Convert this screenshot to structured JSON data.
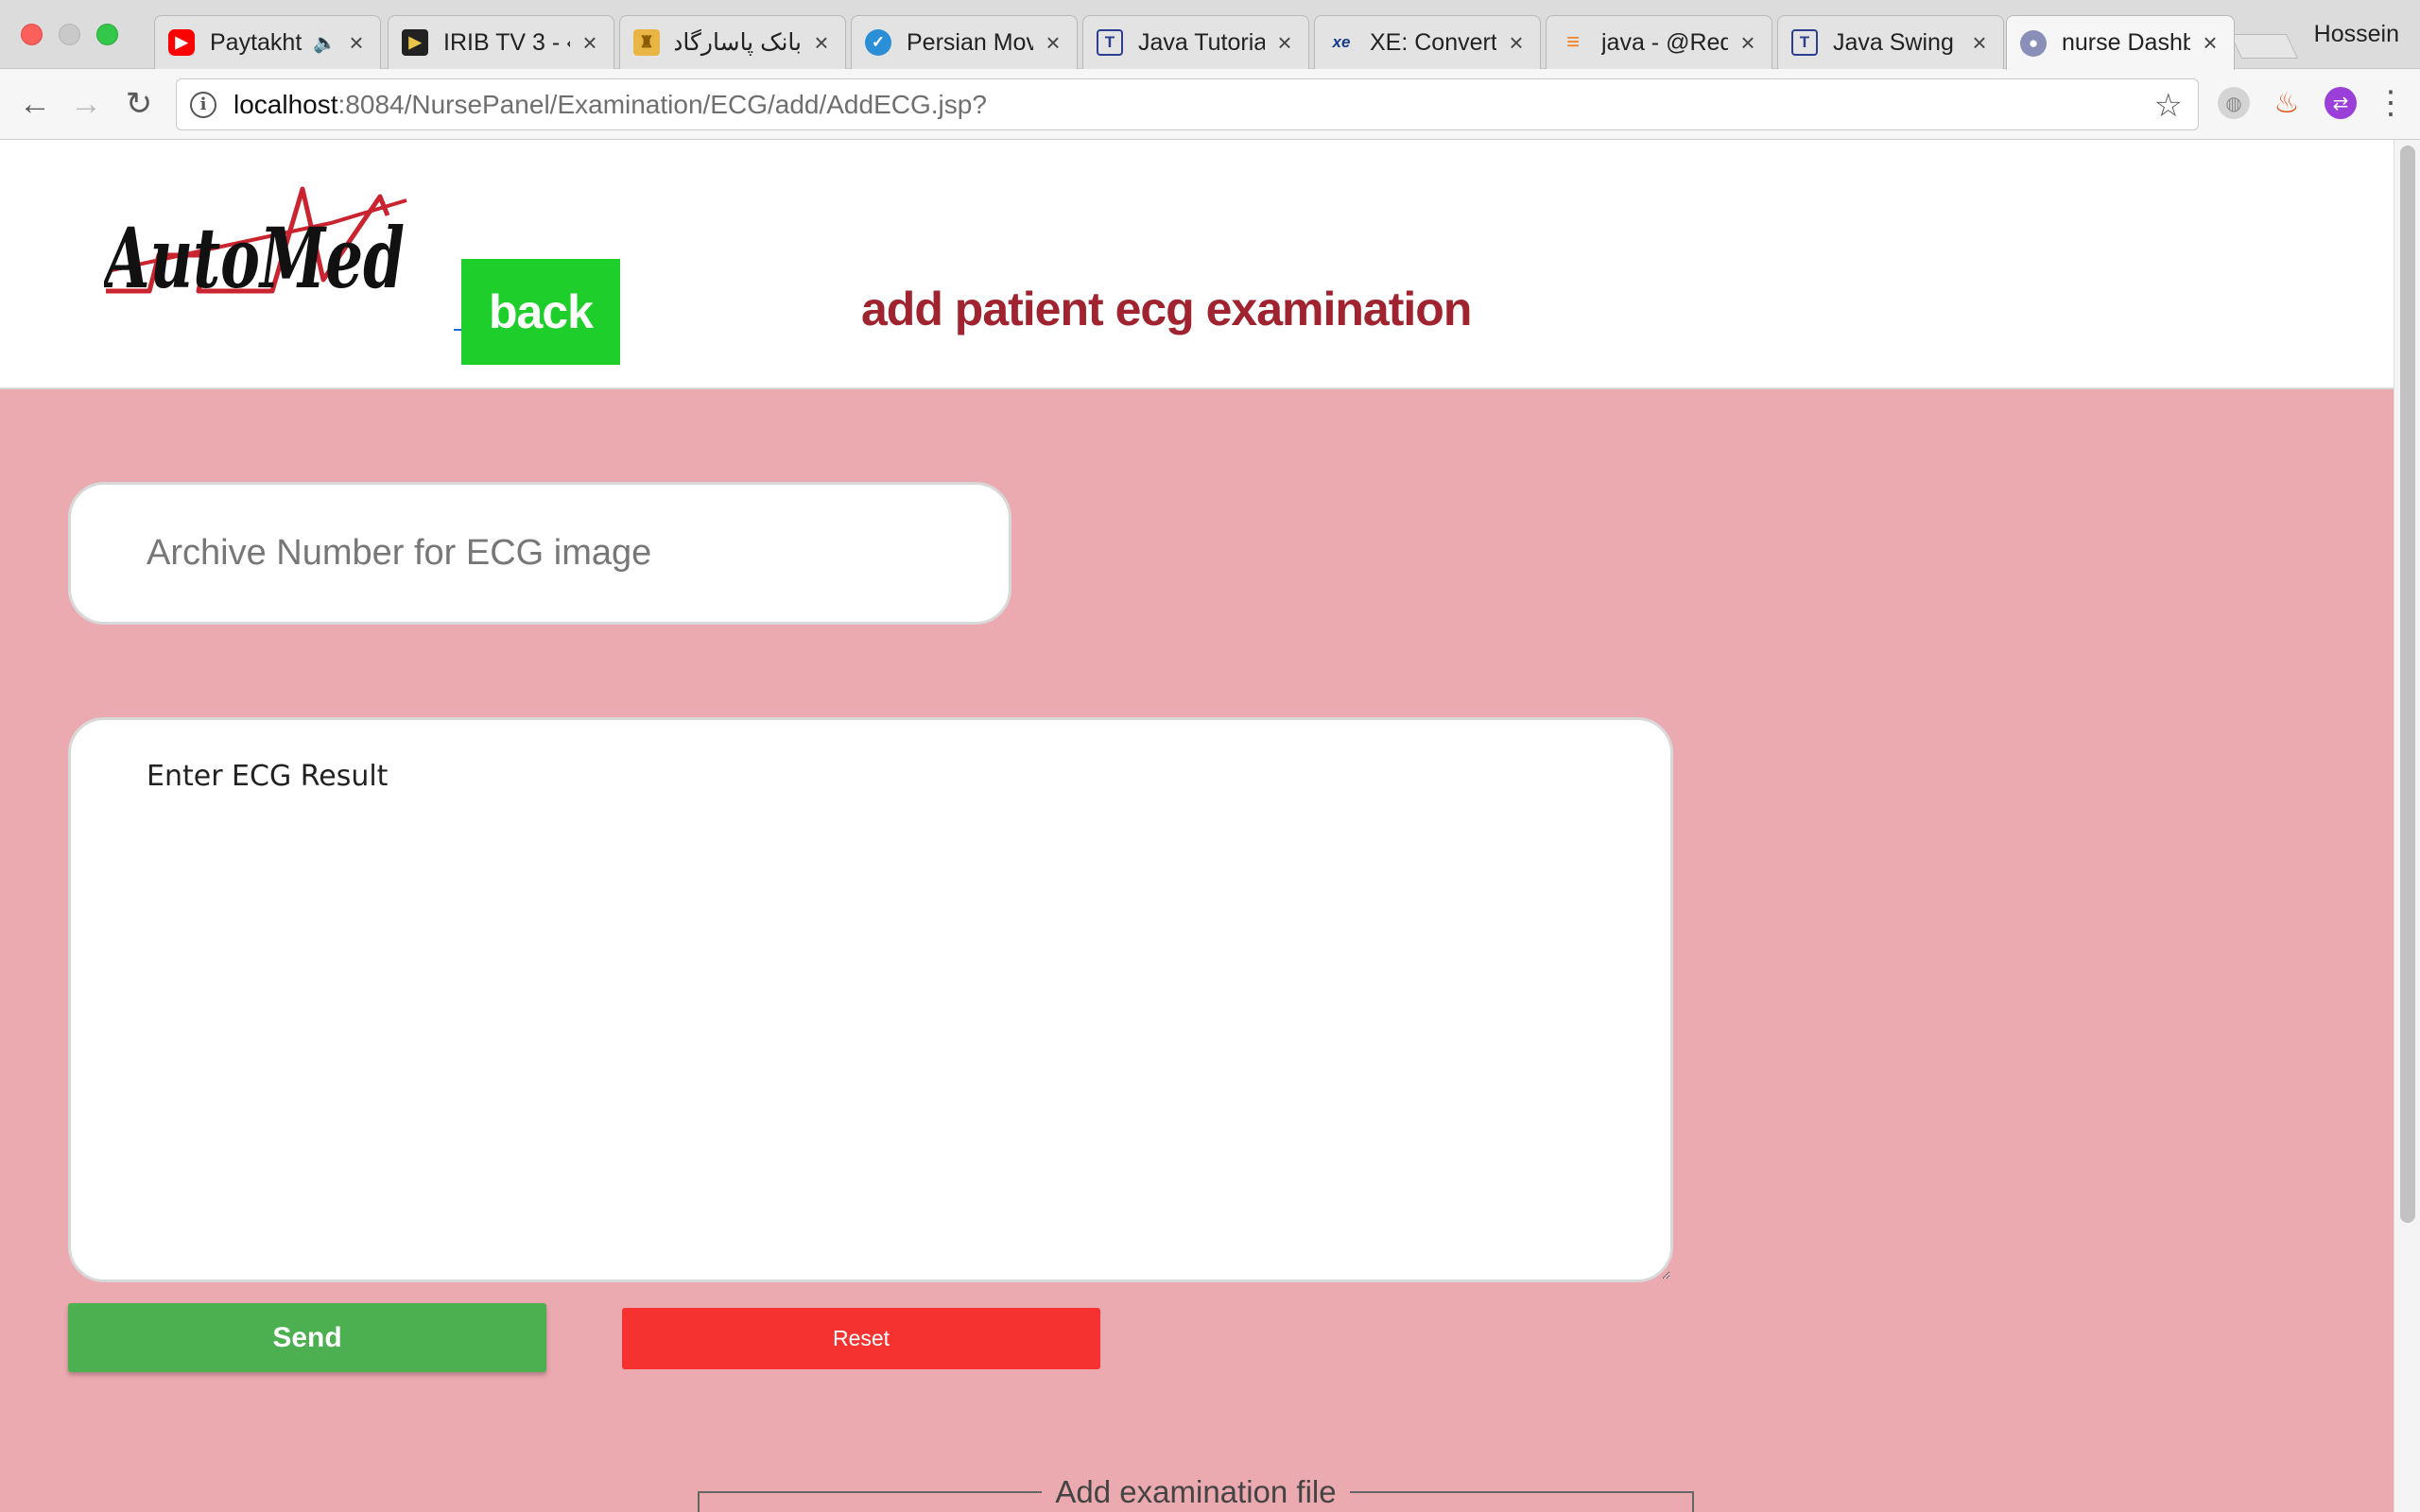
{
  "browser": {
    "tabs": [
      {
        "title": "Paytakht",
        "icon": "youtube-icon",
        "audio": true
      },
      {
        "title": "IRIB TV 3 - «",
        "icon": "play-icon"
      },
      {
        "title": "بانک پاسارگاد ::",
        "icon": "pasargad-icon"
      },
      {
        "title": "Persian Mov",
        "icon": "globe-icon"
      },
      {
        "title": "Java Tutoria",
        "icon": "tutorialspoint-icon"
      },
      {
        "title": "XE: Convert",
        "icon": "xe-icon"
      },
      {
        "title": "java - @Req",
        "icon": "stackoverflow-icon"
      },
      {
        "title": "Java Swing",
        "icon": "tutorialspoint-icon"
      },
      {
        "title": "nurse Dashb",
        "icon": "avatar-icon",
        "active": true
      }
    ],
    "profile_name": "Hossein",
    "url_host": "localhost",
    "url_rest": ":8084/NursePanel/Examination/ECG/add/AddECG.jsp?",
    "close_glyph": "×",
    "audio_glyph": "🔈"
  },
  "header": {
    "logo_text": "AutoMed",
    "back_label": "back",
    "title": "add patient ecg examination"
  },
  "form": {
    "archive_placeholder": "Archive Number for ECG image",
    "result_placeholder": "Enter ECG Result",
    "send_label": "Send",
    "reset_label": "Reset",
    "file_legend": "Add examination file"
  },
  "colors": {
    "page_background": "#eba9b0",
    "back_button": "#1ecf2c",
    "title": "#a0242f",
    "send_button": "#4caf50",
    "reset_button": "#f53230"
  }
}
